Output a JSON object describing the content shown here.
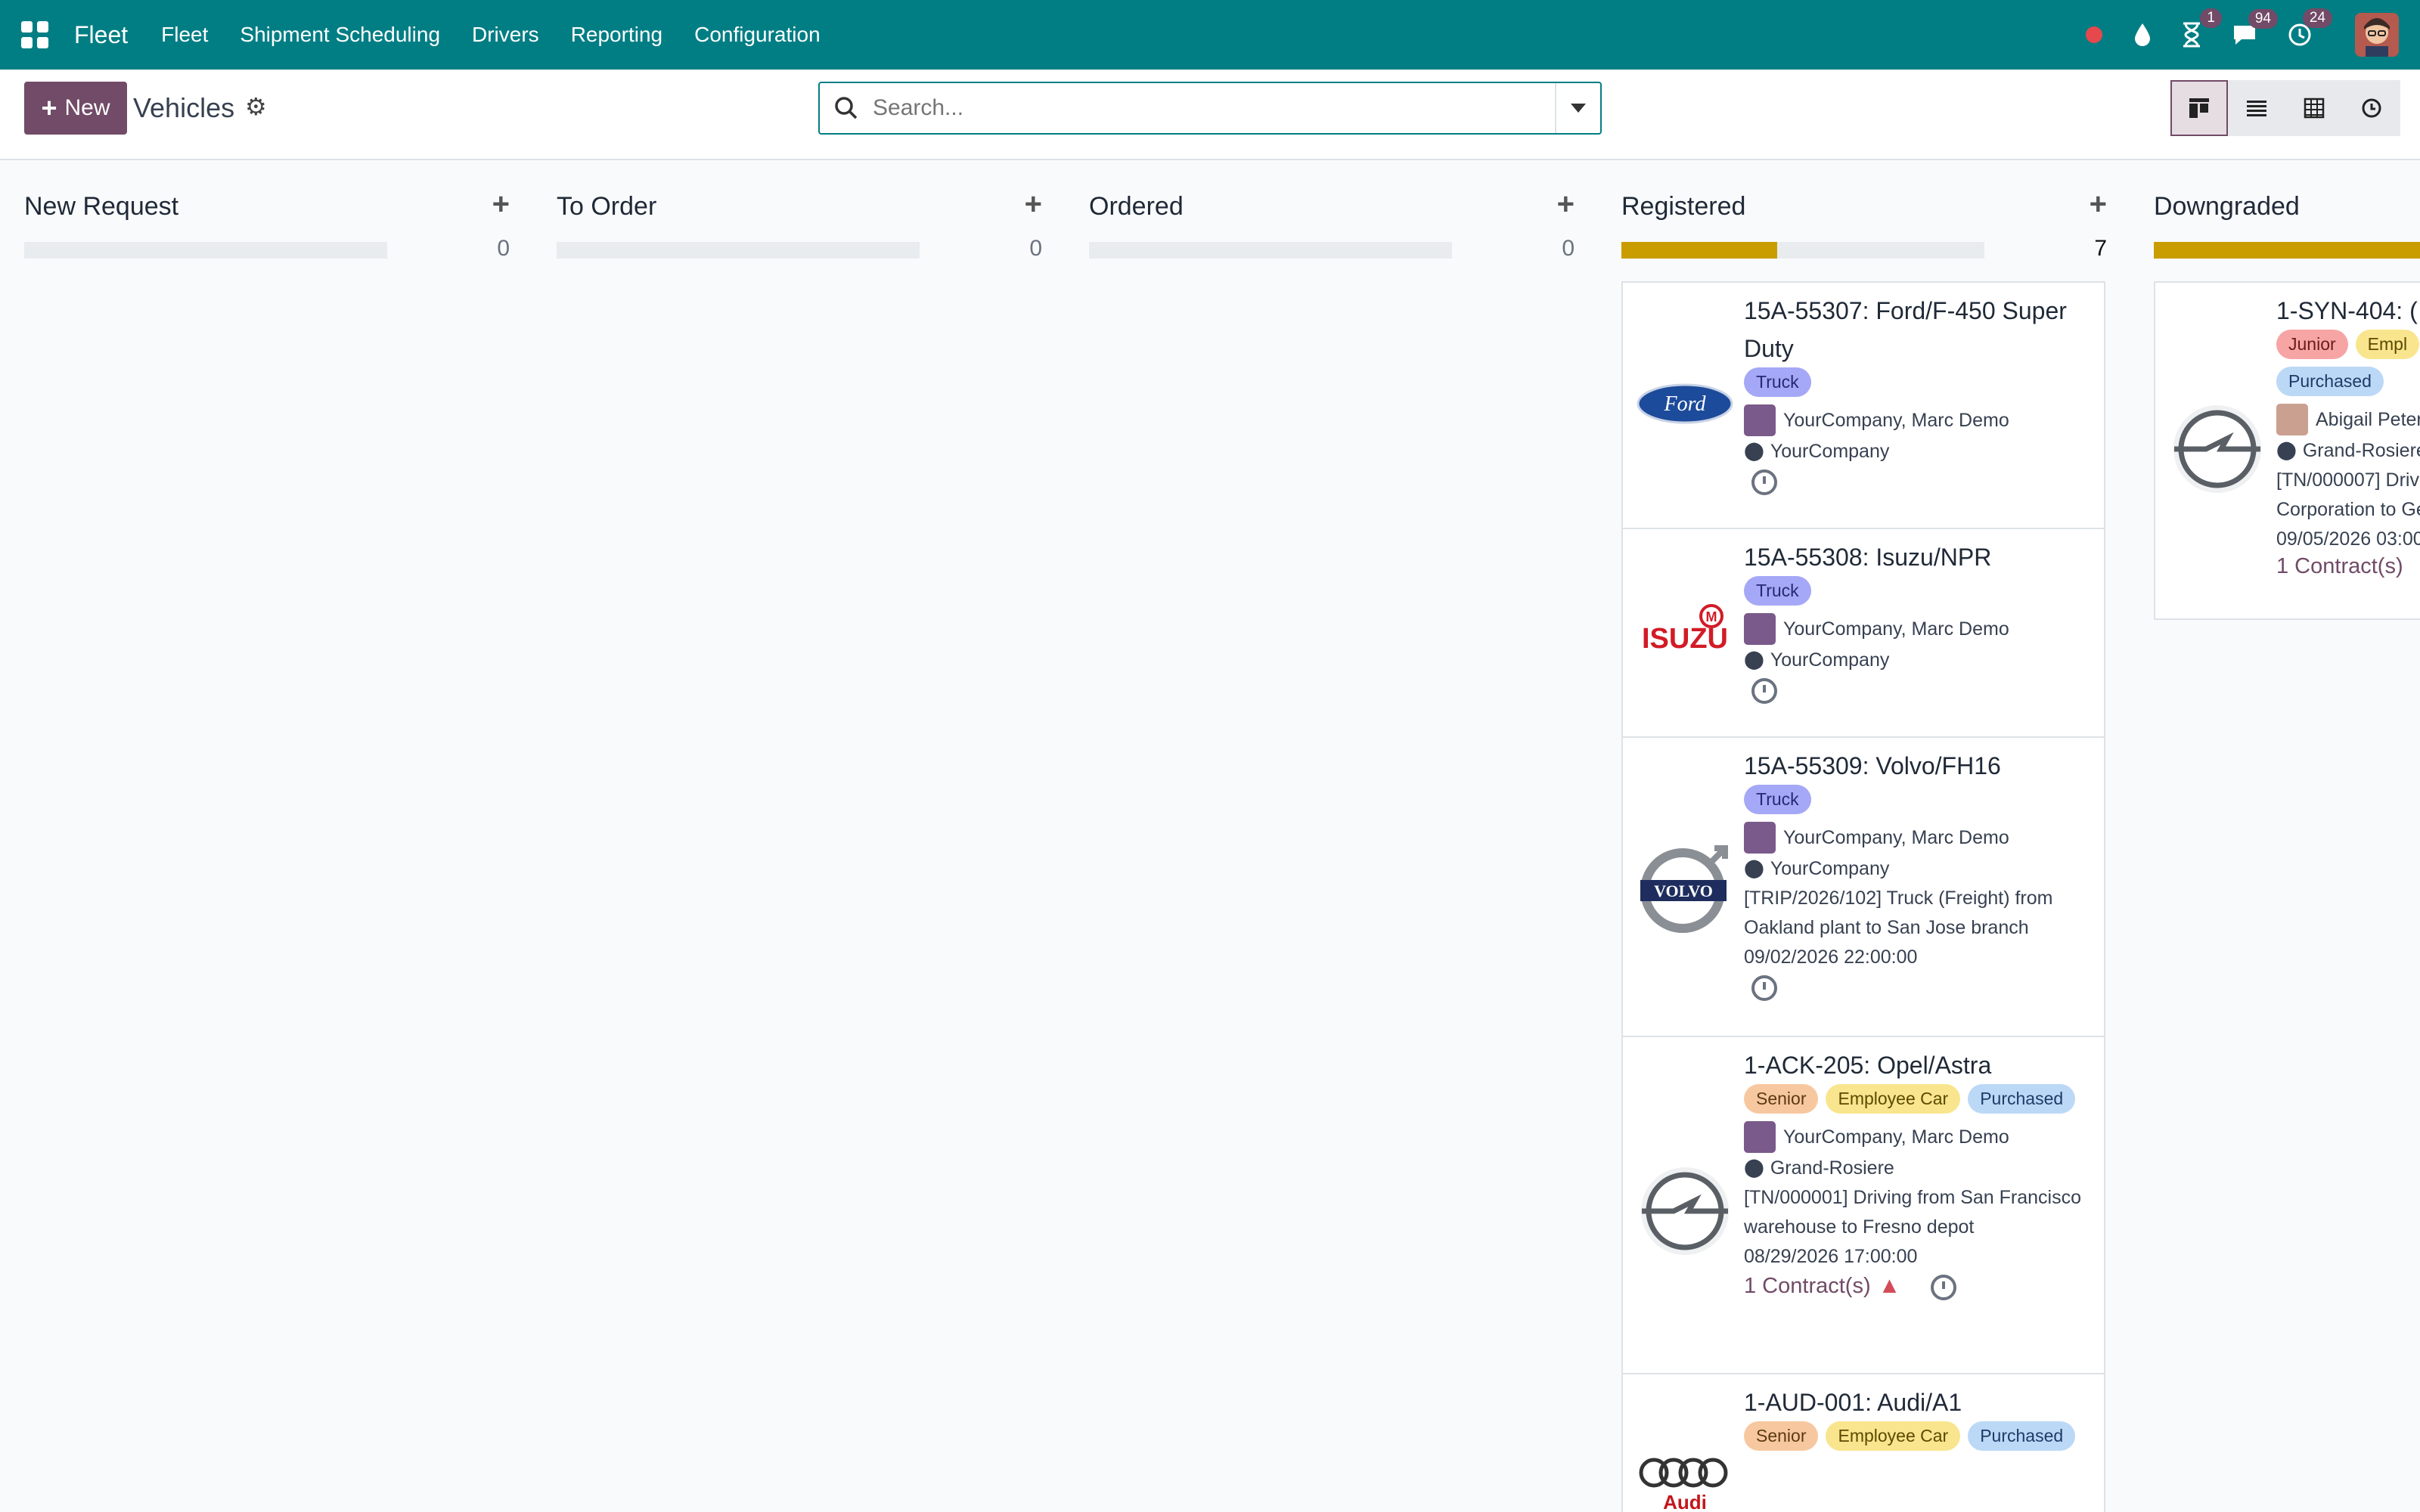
{
  "navbar": {
    "brand": "Fleet",
    "menu": [
      "Fleet",
      "Shipment Scheduling",
      "Drivers",
      "Reporting",
      "Configuration"
    ],
    "systray": {
      "activity_badge": "1",
      "messages_badge": "94",
      "chat_badge": "24"
    }
  },
  "control_panel": {
    "new_label": "New",
    "breadcrumb": "Vehicles",
    "search_placeholder": "Search..."
  },
  "columns": [
    {
      "title": "New Request",
      "count": "0",
      "progress": 0
    },
    {
      "title": "To Order",
      "count": "0",
      "progress": 0
    },
    {
      "title": "Ordered",
      "count": "0",
      "progress": 0
    },
    {
      "title": "Registered",
      "count": "7",
      "progress": 0.43
    },
    {
      "title": "Downgraded",
      "count": "",
      "progress": 1
    }
  ],
  "cards": [
    {
      "title": "15A-55307: Ford/F-450 Super Duty",
      "tag": "Truck",
      "driver": "YourCompany, Marc Demo",
      "location": "YourCompany",
      "logo": "Ford"
    },
    {
      "title": "15A-55308: Isuzu/NPR",
      "tag": "Truck",
      "driver": "YourCompany, Marc Demo",
      "location": "YourCompany",
      "logo": "ISUZU"
    },
    {
      "title": "15A-55309: Volvo/FH16",
      "tag": "Truck",
      "driver": "YourCompany, Marc Demo",
      "location": "YourCompany",
      "note1": "[TRIP/2026/102] Truck (Freight) from",
      "note2": "Oakland plant to San Jose branch",
      "note3": "09/02/2026 22:00:00",
      "logo": "VOLVO"
    },
    {
      "title": "1-ACK-205: Opel/Astra",
      "tags": [
        "Senior",
        "Employee Car",
        "Purchased"
      ],
      "driver": "YourCompany, Marc Demo",
      "location": "Grand-Rosiere",
      "note1": "[TN/000001] Driving from San Francisco",
      "note2": "warehouse to Fresno depot",
      "note3": "08/29/2026 17:00:00",
      "contracts": "1 Contract(s)"
    },
    {
      "title": "1-AUD-001: Audi/A1",
      "tags": [
        "Senior",
        "Employee Car",
        "Purchased"
      ],
      "logo": "Audi"
    }
  ],
  "downgraded_card": {
    "title": "1-SYN-404: (",
    "tags": [
      "Junior",
      "Empl",
      "Purchased"
    ],
    "driver": "Abigail Peter",
    "location": "Grand-Rosiere",
    "note1": "[TN/000007] Driv",
    "note2": "Corporation to Ge",
    "note3": "09/05/2026 03:00",
    "contracts": "1 Contract(s)"
  },
  "colors": {
    "navbar": "#017e84",
    "primary": "#714b67",
    "progress": "#c99d00"
  }
}
